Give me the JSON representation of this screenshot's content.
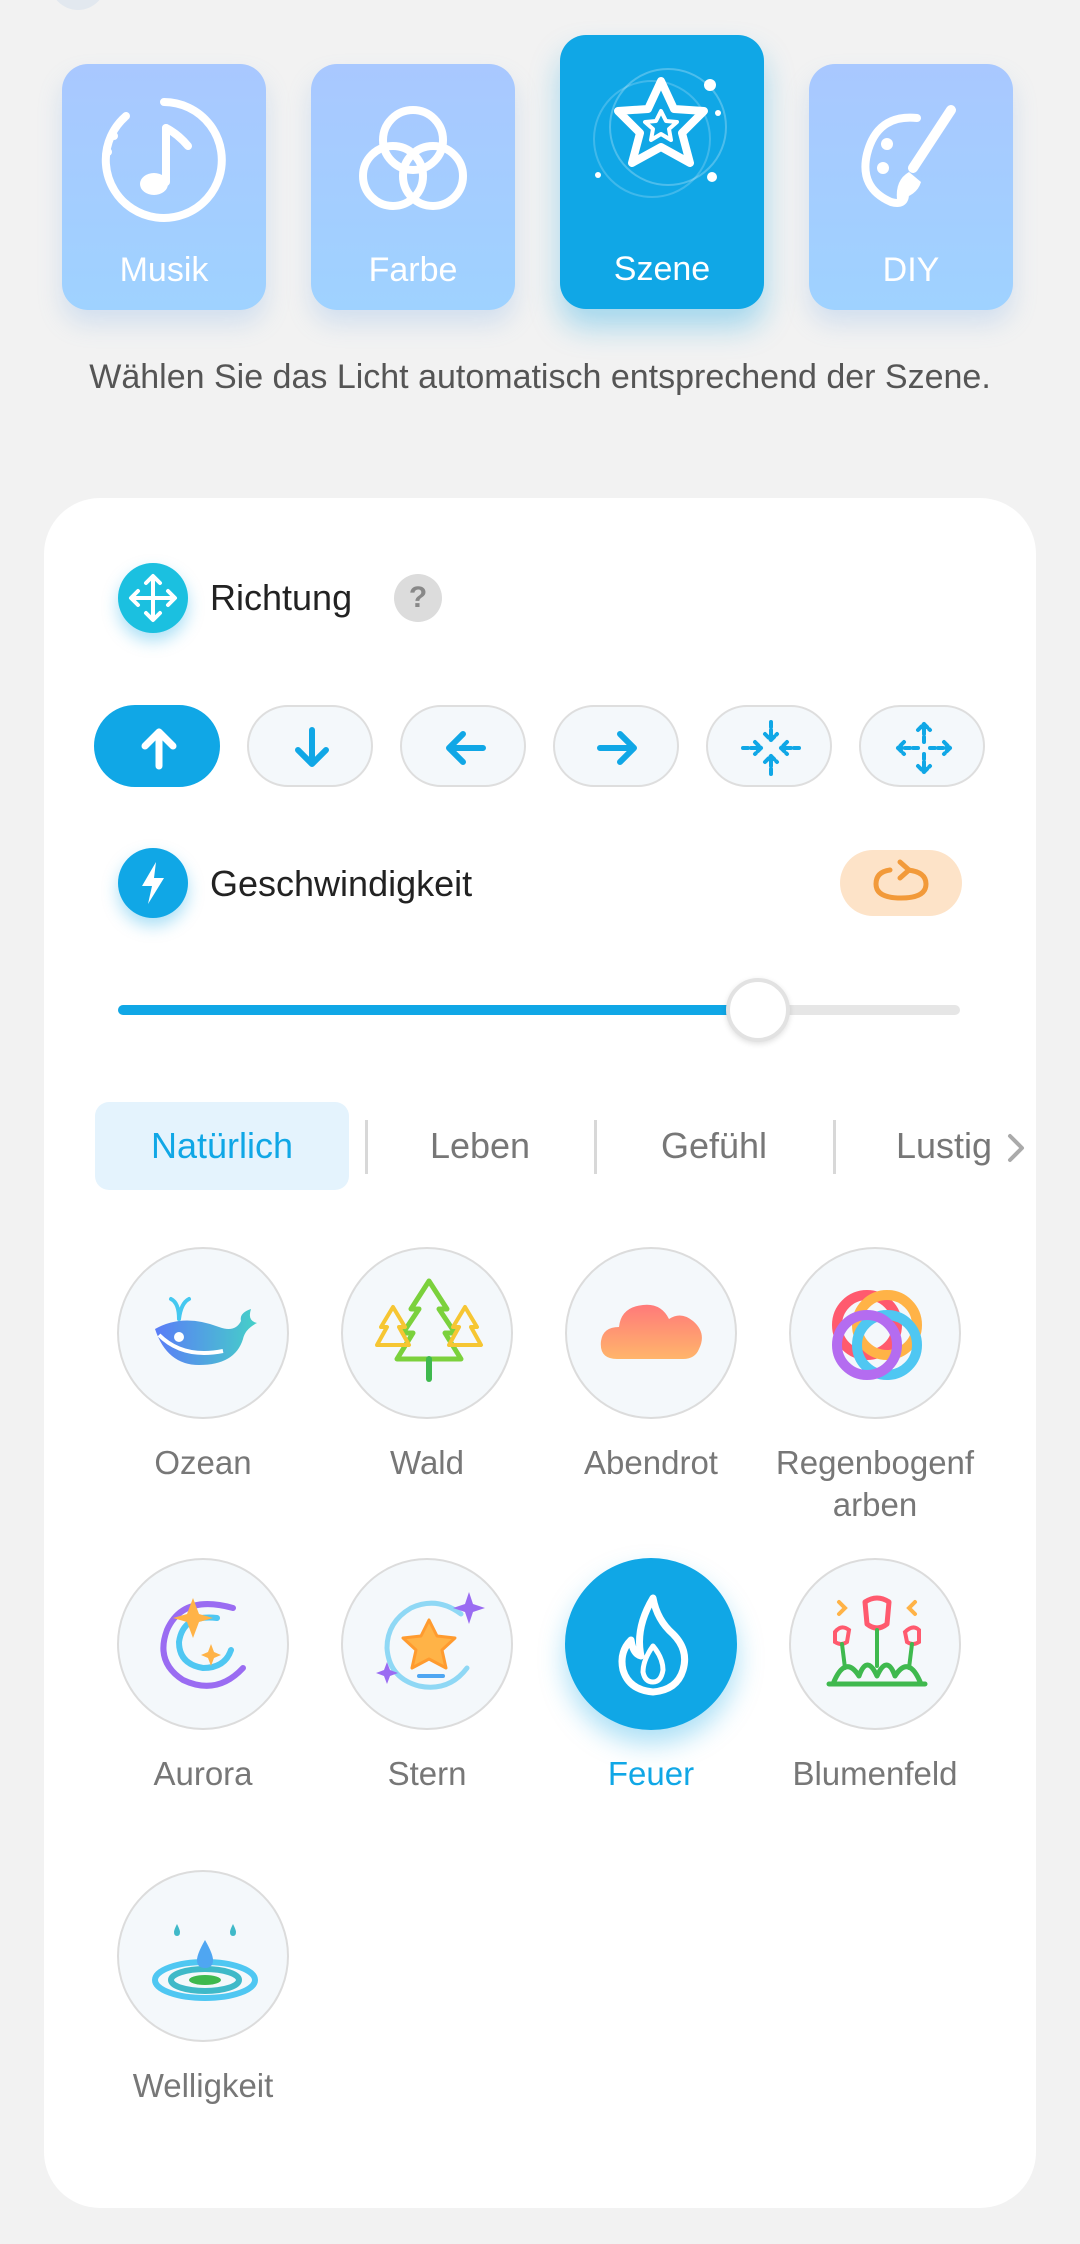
{
  "modes": [
    {
      "label": "Musik",
      "icon": "music-note-icon",
      "active": false
    },
    {
      "label": "Farbe",
      "icon": "color-circles-icon",
      "active": false
    },
    {
      "label": "Szene",
      "icon": "star-scene-icon",
      "active": true
    },
    {
      "label": "DIY",
      "icon": "palette-brush-icon",
      "active": false
    }
  ],
  "description": "Wählen Sie das Licht automatisch entsprechend der Szene.",
  "direction": {
    "title": "Richtung",
    "help": "?",
    "options": [
      "up",
      "down",
      "left",
      "right",
      "converge",
      "diverge"
    ],
    "selected": "up"
  },
  "speed": {
    "title": "Geschwindigkeit",
    "value_fraction": 0.76,
    "loop_icon": "loop-icon"
  },
  "categories": [
    {
      "label": "Natürlich",
      "active": true
    },
    {
      "label": "Leben",
      "active": false
    },
    {
      "label": "Gefühl",
      "active": false
    },
    {
      "label": "Lustig",
      "active": false
    }
  ],
  "scenes": [
    {
      "label": "Ozean",
      "icon": "whale-icon"
    },
    {
      "label": "Wald",
      "icon": "forest-icon"
    },
    {
      "label": "Abendrot",
      "icon": "cloud-icon"
    },
    {
      "label": "Regenbogenf arben",
      "icon": "rainbow-rings-icon"
    },
    {
      "label": "Aurora",
      "icon": "aurora-icon"
    },
    {
      "label": "Stern",
      "icon": "star-icon"
    },
    {
      "label": "Feuer",
      "icon": "flame-icon",
      "active": true
    },
    {
      "label": "Blumenfeld",
      "icon": "flowers-icon"
    },
    {
      "label": "Welligkeit",
      "icon": "ripple-icon"
    }
  ],
  "colors": {
    "accent": "#10a7e6",
    "mode_bg": "#a9c8ff",
    "loop_bg": "#fde3c8",
    "loop_stroke": "#f29a3a"
  }
}
